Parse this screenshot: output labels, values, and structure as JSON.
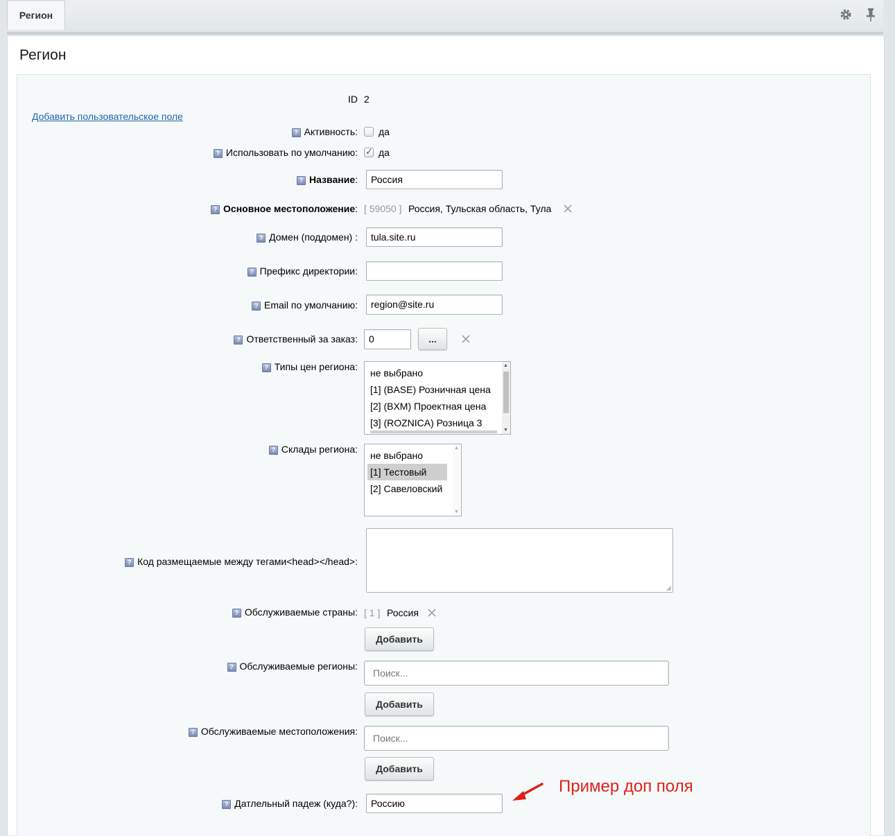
{
  "tab": {
    "label": "Регион"
  },
  "page": {
    "title": "Регион"
  },
  "form": {
    "id_label": "ID",
    "id_value": "2",
    "add_field_link": "Добавить пользовательское поле",
    "active": {
      "label": "Активность:",
      "option": "да",
      "checked": false
    },
    "default": {
      "label": "Использовать по умолчанию:",
      "option": "да",
      "checked": true
    },
    "name": {
      "label": "Название",
      "suffix": ":",
      "value": "Россия"
    },
    "location": {
      "label": "Основное местоположение",
      "suffix": ":",
      "code": "[ 59050 ]",
      "value": "Россия, Тульская область, Тула"
    },
    "domain": {
      "label": "Домен (поддомен) :",
      "value": "tula.site.ru"
    },
    "prefix": {
      "label": "Префикс директории:",
      "value": ""
    },
    "email": {
      "label": "Email по умолчанию:",
      "value": "region@site.ru"
    },
    "responsible": {
      "label": "Ответственный за заказ:",
      "value": "0",
      "button": "..."
    },
    "price_types": {
      "label": "Типы цен региона:",
      "options": [
        "не выбрано",
        "[1] (BASE) Розничная цена",
        "[2] (BXM) Проектная цена",
        "[3] (ROZNICA) Розница 3"
      ]
    },
    "stores": {
      "label": "Склады региона:",
      "options": [
        "не выбрано",
        "[1] Тестовый",
        "[2] Савеловский"
      ],
      "selected_index": 1
    },
    "head_code": {
      "label": "Код размещаемые между тегами<head></head>:"
    },
    "countries": {
      "label": "Обслуживаемые страны:",
      "code": "[ 1 ]",
      "value": "Россия",
      "button": "Добавить"
    },
    "regions": {
      "label": "Обслуживаемые регионы:",
      "placeholder": "Поиск...",
      "button": "Добавить"
    },
    "locations": {
      "label": "Обслуживаемые местоположения:",
      "placeholder": "Поиск...",
      "button": "Добавить"
    },
    "dative": {
      "label": "Датлельный падеж (куда?):",
      "value": "Россию"
    }
  },
  "annotation": {
    "text": "Пример доп поля",
    "color": "#e0201a"
  },
  "icons": {
    "gear": "gear-icon",
    "pin": "pin-icon",
    "help": "help-icon",
    "remove": "close-icon"
  }
}
